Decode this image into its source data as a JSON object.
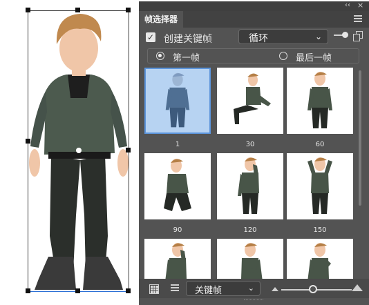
{
  "panel": {
    "tab_label": "帧选择器",
    "collapse_glyph": "‹‹",
    "close_glyph": "×"
  },
  "controls": {
    "create_keyframe_checked": true,
    "create_keyframe_label": "创建关键帧",
    "loop_mode_value": "循环",
    "frame_option_first": "第一帧",
    "frame_option_last": "最后一帧",
    "selected_frame_option": "first"
  },
  "frames": [
    {
      "label": "1",
      "selected": true,
      "pose": "stand"
    },
    {
      "label": "30",
      "selected": false,
      "pose": "sit"
    },
    {
      "label": "60",
      "selected": false,
      "pose": "back"
    },
    {
      "label": "90",
      "selected": false,
      "pose": "crouch"
    },
    {
      "label": "120",
      "selected": false,
      "pose": "think"
    },
    {
      "label": "150",
      "selected": false,
      "pose": "hands-head"
    },
    {
      "label": "",
      "selected": false,
      "pose": "scratch"
    },
    {
      "label": "",
      "selected": false,
      "pose": "arms-crossed"
    },
    {
      "label": "",
      "selected": false,
      "pose": "hand-chest"
    }
  ],
  "bottom_bar": {
    "view_mode_value": "关键帧",
    "zoom_fraction": 0.45
  },
  "colors": {
    "panel_bg": "#535353",
    "selected_frame_bg": "#b7d3f2",
    "selected_frame_border": "#5c95dc"
  }
}
